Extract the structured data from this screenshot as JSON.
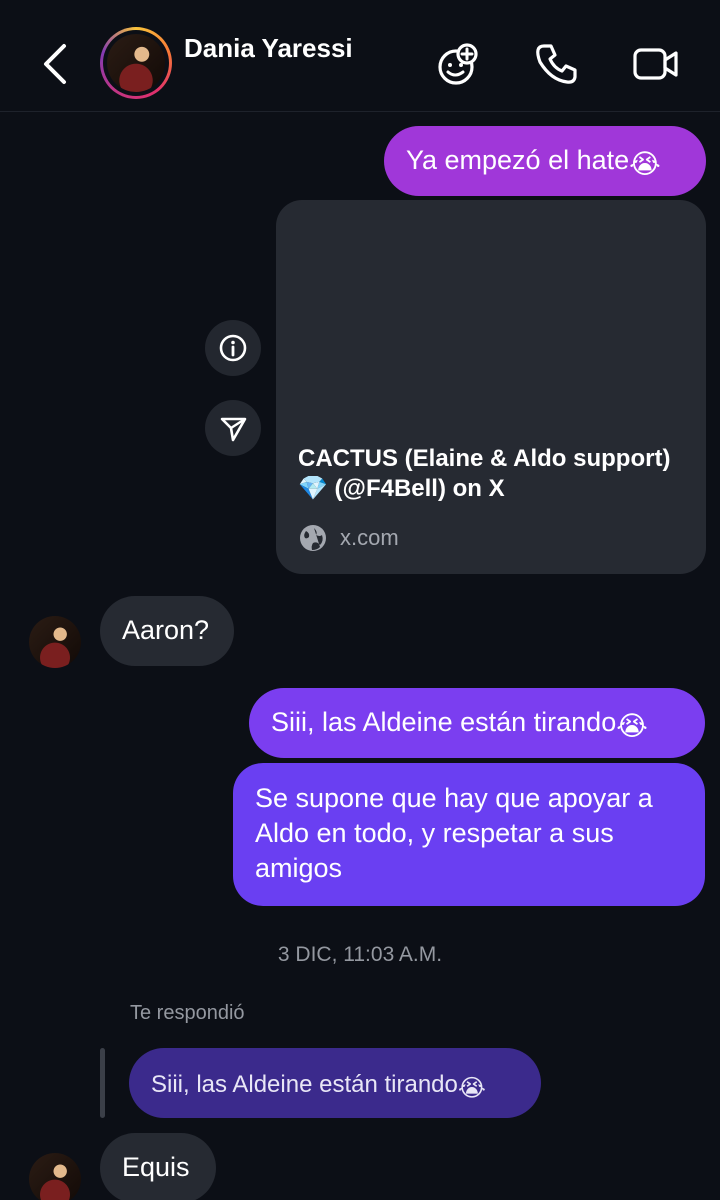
{
  "header": {
    "contact_name": "Dania Yaressi",
    "icons": [
      "back-icon",
      "add-friend-icon",
      "phone-icon",
      "video-icon"
    ]
  },
  "messages": {
    "m1": {
      "text": "Ya empezó el hate",
      "emoji": "😭"
    },
    "link_card": {
      "title": "CACTUS (Elaine & Aldo support) 💎 (@F4Bell) on X",
      "domain": "x.com"
    },
    "m2": {
      "text": "Aaron?"
    },
    "m3": {
      "text": "Siii, las Aldeine están tirando",
      "emoji": "😭"
    },
    "m4": {
      "line1": "Se supone que hay que apoyar a",
      "line2": "Aldo en todo, y respetar a sus",
      "line3": "amigos"
    },
    "timestamp": "3 DIC, 11:03 A.M.",
    "reply_label": "Te respondió",
    "reply_quote": {
      "text": "Siii, las Aldeine están tirando",
      "emoji": "😭"
    },
    "m5": {
      "text": "Equis"
    }
  },
  "colors": {
    "background": "#0c0f16",
    "bubble_purple_1": "#a037d9",
    "bubble_purple_2": "#7b3ef0",
    "bubble_purple_3": "#6a3ff2",
    "bubble_incoming": "#262a32"
  }
}
